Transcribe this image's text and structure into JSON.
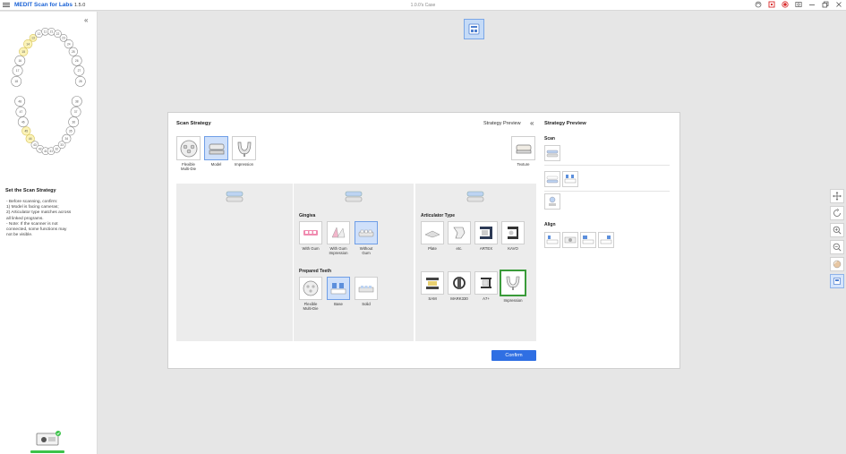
{
  "app": {
    "brand": "MEDIT Scan for Labs",
    "version": "1.5.0",
    "case_name": "1.0.0's Case"
  },
  "sidebar": {
    "title": "Set the Scan Strategy",
    "notes": "- Before scanning, confirm:\n  1) Model is facing cameras;\n  2) Articulator type matches across\n     all linked programs.\n- Note: If the scanner is not\n  connected, some functions may\n  not be visible.",
    "tooth_numbers_upper": [
      "18",
      "17",
      "16",
      "15",
      "14",
      "13",
      "12",
      "11",
      "21",
      "22",
      "23",
      "24",
      "25",
      "26",
      "27",
      "28"
    ],
    "tooth_numbers_lower": [
      "48",
      "47",
      "46",
      "45",
      "44",
      "43",
      "42",
      "41",
      "31",
      "32",
      "33",
      "34",
      "35",
      "36",
      "37",
      "38"
    ]
  },
  "dialog": {
    "title": "Scan Strategy",
    "strategy_preview_link": "Strategy Preview",
    "preview_title": "Strategy Preview",
    "types": [
      {
        "label": "Flexible\nMulti-Die",
        "selected": false
      },
      {
        "label": "Model",
        "selected": true
      },
      {
        "label": "Impression",
        "selected": false
      }
    ],
    "texture_label": "Texture",
    "gingiva": {
      "label": "Gingiva",
      "options": [
        {
          "label": "With Gum",
          "selected": false
        },
        {
          "label": "With Gum\nImpression",
          "selected": false
        },
        {
          "label": "Without\nGum",
          "selected": true
        }
      ]
    },
    "prepared_teeth": {
      "label": "Prepared Teeth",
      "options": [
        {
          "label": "Flexible\nMulti-Die",
          "selected": false
        },
        {
          "label": "Base",
          "selected": true
        },
        {
          "label": "Solid",
          "selected": false
        }
      ]
    },
    "articulator": {
      "label": "Articulator Type",
      "options_row1": [
        "Plate",
        "etc.",
        "ARTEX",
        "KAVO"
      ],
      "options_row2": [
        "SAM",
        "MARK330",
        "A7+",
        "Impression"
      ],
      "highlighted": "Impression"
    },
    "confirm_label": "Confirm",
    "preview": {
      "scan_label": "Scan",
      "align_label": "Align"
    }
  },
  "colors": {
    "brand_blue": "#1a62d6",
    "selected_bg": "#cfe0fa",
    "confirm_blue": "#2f6fe3",
    "highlight_green": "#3a9b3a",
    "device_green": "#3cc34a"
  }
}
